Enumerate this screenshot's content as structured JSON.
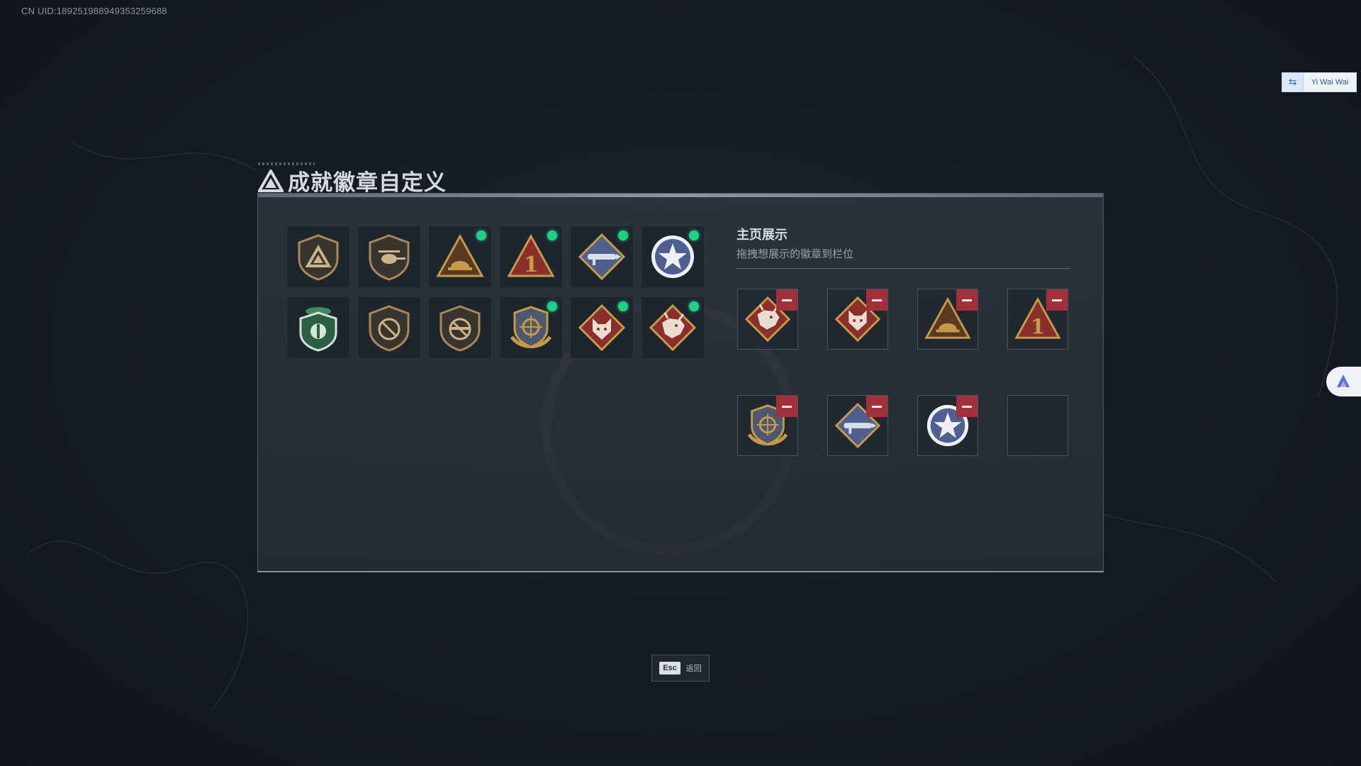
{
  "uid_label": "CN UID:189251988949353259688",
  "user_tag": {
    "swap_icon": "swap-arrow-icon",
    "name": "Yi Wai Wai"
  },
  "side_assist": {
    "icon": "assistant-icon"
  },
  "title": "成就徽章自定义",
  "showcase": {
    "title": "主页展示",
    "subtitle": "拖拽想展示的徽章到栏位"
  },
  "badges": [
    {
      "icon": "delta-triangle-shield-badge",
      "new": false
    },
    {
      "icon": "helicopter-shield-badge",
      "new": false
    },
    {
      "icon": "gold-triangle-helmet-badge",
      "new": true
    },
    {
      "icon": "red-triangle-number-one-badge",
      "new": true
    },
    {
      "icon": "blue-diamond-rocket-badge",
      "new": true
    },
    {
      "icon": "blue-star-circle-badge",
      "new": true
    },
    {
      "icon": "green-beret-shield-badge",
      "new": false
    },
    {
      "icon": "no-weapon-shield-badge",
      "new": false
    },
    {
      "icon": "no-rifle-shield-badge",
      "new": false
    },
    {
      "icon": "gold-crosshair-emblem-badge",
      "new": true
    },
    {
      "icon": "red-diamond-wolf-badge",
      "new": true
    },
    {
      "icon": "red-diamond-dragon-badge",
      "new": true
    }
  ],
  "slots": [
    {
      "icon": "red-diamond-dragon-badge",
      "filled": true
    },
    {
      "icon": "red-diamond-wolf-badge",
      "filled": true
    },
    {
      "icon": "gold-triangle-helmet-badge",
      "filled": true
    },
    {
      "icon": "red-triangle-number-one-badge",
      "filled": true
    },
    {
      "icon": "gold-crosshair-emblem-badge",
      "filled": true
    },
    {
      "icon": "blue-diamond-rocket-badge",
      "filled": true
    },
    {
      "icon": "blue-star-circle-badge",
      "filled": true
    },
    {
      "icon": "",
      "filled": false
    }
  ],
  "badge_one_numeral": "1",
  "esc": {
    "key": "Esc",
    "label": "返回"
  },
  "colors": {
    "new_dot": "#1fcf86",
    "remove": "#a0303a",
    "gold": "#c79a4a",
    "red": "#8a2f2c",
    "blue": "#4f5f8f",
    "green": "#3f8a5e"
  }
}
